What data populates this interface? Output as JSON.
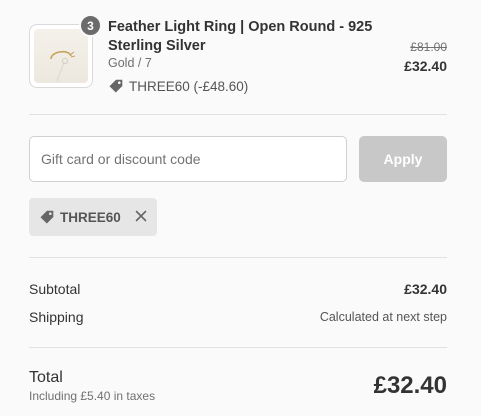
{
  "cart_item": {
    "quantity": "3",
    "title": "Feather Light Ring | Open Round - 925 Sterling Silver",
    "variant": "Gold / 7",
    "discount_line": "THREE60 (-£48.60)",
    "original_price": "£81.00",
    "price": "£32.40"
  },
  "discount": {
    "placeholder": "Gift card or discount code",
    "apply_label": "Apply",
    "applied_code": "THREE60"
  },
  "summary": {
    "subtotal_label": "Subtotal",
    "subtotal_value": "£32.40",
    "shipping_label": "Shipping",
    "shipping_value": "Calculated at next step",
    "total_label": "Total",
    "tax_note": "Including £5.40 in taxes",
    "total_value": "£32.40"
  },
  "icons": {
    "tag": "tag-icon",
    "remove": "close-icon"
  },
  "colors": {
    "apply_button_disabled": "#c8c8c8",
    "quantity_badge": "#6b6b6b",
    "chip_background": "#e6e6e6"
  }
}
